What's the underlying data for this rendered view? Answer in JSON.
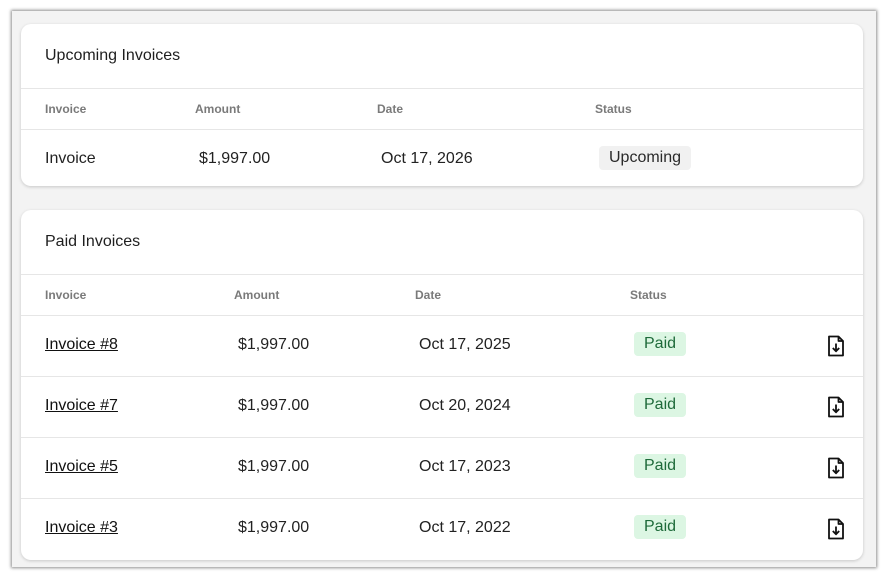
{
  "upcoming": {
    "title": "Upcoming Invoices",
    "columns": [
      "Invoice",
      "Amount",
      "Date",
      "Status"
    ],
    "rows": [
      {
        "invoice": "Invoice",
        "amount": "$1,997.00",
        "date": "Oct 17, 2026",
        "status": "Upcoming"
      }
    ]
  },
  "paid": {
    "title": "Paid Invoices",
    "columns": [
      "Invoice",
      "Amount",
      "Date",
      "Status"
    ],
    "rows": [
      {
        "invoice": "Invoice #8",
        "amount": "$1,997.00",
        "date": "Oct 17, 2025",
        "status": "Paid",
        "action_icon": "download-file-icon"
      },
      {
        "invoice": "Invoice #7",
        "amount": "$1,997.00",
        "date": "Oct 20, 2024",
        "status": "Paid",
        "action_icon": "download-file-icon"
      },
      {
        "invoice": "Invoice #5",
        "amount": "$1,997.00",
        "date": "Oct 17, 2023",
        "status": "Paid",
        "action_icon": "download-file-icon"
      },
      {
        "invoice": "Invoice #3",
        "amount": "$1,997.00",
        "date": "Oct 17, 2022",
        "status": "Paid",
        "action_icon": "download-file-icon"
      }
    ]
  },
  "colors": {
    "paid_badge_bg": "#dcf6e3",
    "paid_badge_text": "#1e6a3a",
    "upcoming_badge_bg": "#f1f1f1"
  }
}
